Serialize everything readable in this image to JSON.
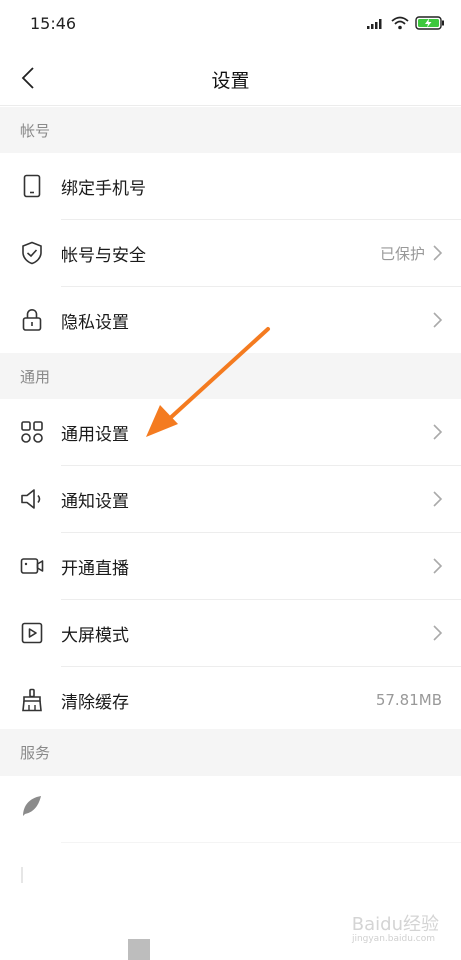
{
  "status_bar": {
    "time": "15:46"
  },
  "header": {
    "title": "设置"
  },
  "sections": [
    {
      "header": "帐号"
    },
    {
      "header": "通用"
    },
    {
      "header": "服务"
    }
  ],
  "account_rows": [
    {
      "label": "绑定手机号",
      "icon": "phone-icon",
      "value": ""
    },
    {
      "label": "帐号与安全",
      "icon": "shield-icon",
      "value": "已保护"
    },
    {
      "label": "隐私设置",
      "icon": "lock-icon",
      "value": ""
    }
  ],
  "general_rows": [
    {
      "label": "通用设置",
      "icon": "grid-icon",
      "value": ""
    },
    {
      "label": "通知设置",
      "icon": "speaker-icon",
      "value": ""
    },
    {
      "label": "开通直播",
      "icon": "camera-icon",
      "value": ""
    },
    {
      "label": "大屏模式",
      "icon": "play-screen-icon",
      "value": ""
    },
    {
      "label": "清除缓存",
      "icon": "broom-icon",
      "value": "57.81MB"
    }
  ],
  "watermark": {
    "text": "Baidu经验",
    "sub": "jingyan.baidu.com"
  },
  "colors": {
    "accent_arrow": "#f47b20",
    "section_bg": "#f5f5f5",
    "secondary_text": "#999999"
  }
}
